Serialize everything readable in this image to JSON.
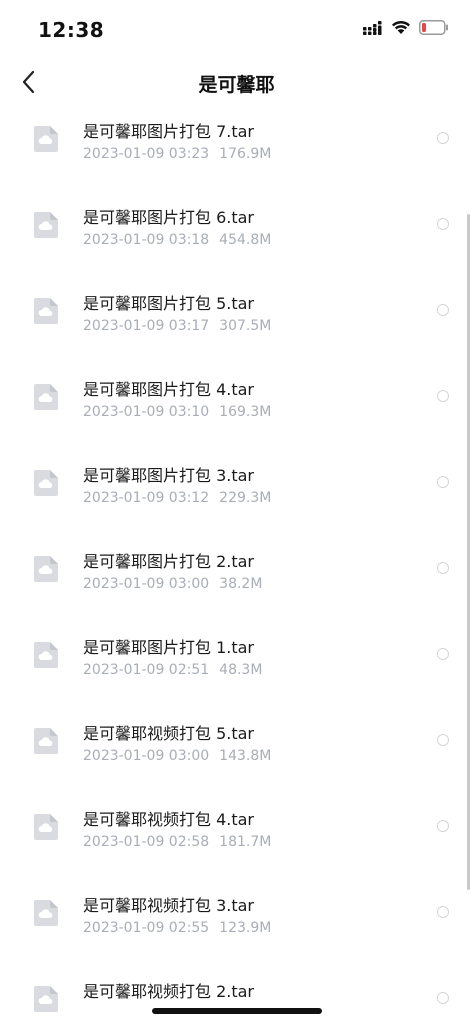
{
  "status_bar": {
    "time": "12:38",
    "icons": [
      "signal-icon",
      "wifi-icon",
      "battery-low-icon"
    ]
  },
  "nav": {
    "title": "是可馨耶",
    "back_icon": "chevron-left-icon"
  },
  "files": [
    {
      "name": "是可馨耶图片打包 7.tar",
      "date": "2023-01-09 03:23",
      "size": "176.9M"
    },
    {
      "name": "是可馨耶图片打包 6.tar",
      "date": "2023-01-09 03:18",
      "size": "454.8M"
    },
    {
      "name": "是可馨耶图片打包 5.tar",
      "date": "2023-01-09 03:17",
      "size": "307.5M"
    },
    {
      "name": "是可馨耶图片打包 4.tar",
      "date": "2023-01-09 03:10",
      "size": "169.3M"
    },
    {
      "name": "是可馨耶图片打包 3.tar",
      "date": "2023-01-09 03:12",
      "size": "229.3M"
    },
    {
      "name": "是可馨耶图片打包 2.tar",
      "date": "2023-01-09 03:00",
      "size": "38.2M"
    },
    {
      "name": "是可馨耶图片打包 1.tar",
      "date": "2023-01-09 02:51",
      "size": "48.3M"
    },
    {
      "name": "是可馨耶视频打包 5.tar",
      "date": "2023-01-09 03:00",
      "size": "143.8M"
    },
    {
      "name": "是可馨耶视频打包 4.tar",
      "date": "2023-01-09 02:58",
      "size": "181.7M"
    },
    {
      "name": "是可馨耶视频打包 3.tar",
      "date": "2023-01-09 02:55",
      "size": "123.9M"
    },
    {
      "name": "是可馨耶视频打包 2.tar",
      "date": "",
      "size": ""
    }
  ],
  "colors": {
    "battery_low": "#e5484d",
    "meta_text": "#a8adb8",
    "icon_fill": "#d9dbe0"
  }
}
